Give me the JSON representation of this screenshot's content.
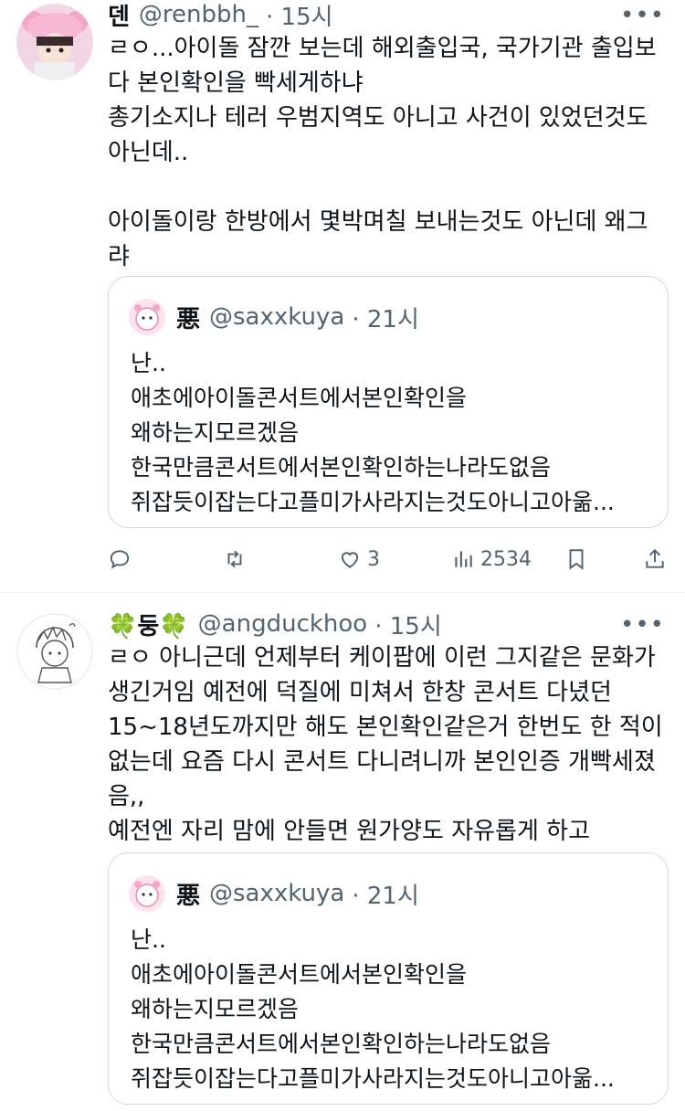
{
  "tweets": [
    {
      "author_name": "덴",
      "handle": "@renbbh_",
      "time": "· 15시",
      "more": "•••",
      "text": "ㄹㅇ...아이돌 잠깐 보는데 해외출입국, 국가기관 출입보\n다 본인확인을 빡세게하냐\n총기소지나 테러 우범지역도 아니고 사건이 있었던것도\n아닌데..\n\n아이돌이랑 한방에서 몇박며칠 보내는것도 아닌데 왜그\n랴",
      "quote": {
        "author_name": "悪",
        "handle": "@saxxkuya",
        "time": "· 21시",
        "text": "난..\n애초에아이돌콘서트에서본인확인을\n왜하는지모르겠음\n한국만큼콘서트에서본인확인하는나라도없음\n쥐잡듯이잡는다고플미가사라지는것도아니고아욺..."
      },
      "actions": {
        "reply_icon": "reply-icon",
        "retweet_icon": "retweet-icon",
        "like_icon": "heart-icon",
        "like_count": "3",
        "views_icon": "views-icon",
        "views_count": "2534",
        "bookmark_icon": "bookmark-icon",
        "share_icon": "share-icon"
      }
    },
    {
      "author_name": "🍀둥🍀",
      "handle": "@angduckhoo",
      "time": "· 15시",
      "more": "•••",
      "text": "ㄹㅇ 아니근데 언제부터 케이팝에 이런 그지같은 문화가\n생긴거임 예전에 덕질에 미쳐서 한창 콘서트 다녔던\n15~18년도까지만 해도 본인확인같은거 한번도 한 적이\n없는데 요즘 다시 콘서트 다니려니까 본인인증 개빡세졌\n음,,\n예전엔 자리 맘에 안들면 원가양도 자유롭게 하고",
      "quote": {
        "author_name": "悪",
        "handle": "@saxxkuya",
        "time": "· 21시",
        "text": "난..\n애초에아이돌콘서트에서본인확인을\n왜하는지모르겠음\n한국만큼콘서트에서본인확인하는나라도없음\n쥐잡듯이잡는다고플미가사라지는것도아니고아욺..."
      }
    }
  ],
  "colors": {
    "text": "#0f1419",
    "muted": "#536471",
    "border": "#cfd9de",
    "divider": "#eff3f4"
  }
}
